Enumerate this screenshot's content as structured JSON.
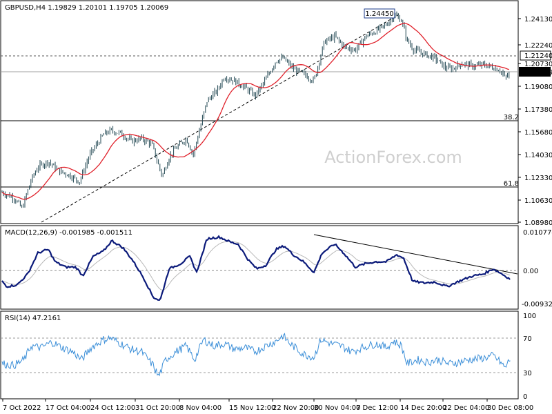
{
  "colors": {
    "candle": "#1f4550",
    "ma": "#e0202a",
    "macd": "#0b1a7a",
    "signal": "#b8b8b8",
    "rsi": "#3a8ed8",
    "frame": "#000000",
    "dotted": "#555555",
    "fibo": "#a0a0a0",
    "watermark": "#cfcfcf"
  },
  "price_panel": {
    "header": "GBPUSD,H4  1.19829 1.20101 1.19705 1.20069",
    "ticks": [
      "1.24130",
      "1.22240",
      "1.20730",
      "1.19080",
      "1.17380",
      "1.15680",
      "1.14030",
      "1.12330",
      "1.10630",
      "1.08980"
    ],
    "current_price_label": "1.20069",
    "resistance_label": "1.21240",
    "peak_label": "1.24450",
    "fib_382": "38.2",
    "fib_618": "61.8",
    "watermark": "ActionForex.com"
  },
  "macd_panel": {
    "header": "MACD(12,26,9) -0.001985 -0.001511",
    "ticks": [
      "0.010774",
      "0.00",
      "-0.009328"
    ]
  },
  "rsi_panel": {
    "header": "RSI(14) 47.2161",
    "ticks": [
      "100",
      "70",
      "30",
      "0"
    ]
  },
  "time_axis": [
    "7 Oct 2022",
    "17 Oct 04:00",
    "24 Oct 12:00",
    "31 Oct 20:00",
    "8 Nov 04:00",
    "15 Nov 12:00",
    "22 Nov 20:00",
    "30 Nov 04:00",
    "7 Dec 12:00",
    "14 Dec 20:00",
    "22 Dec 04:00",
    "30 Dec 08:00"
  ],
  "chart_data": {
    "type": "line",
    "title": "GBPUSD,H4",
    "x": [
      "7 Oct 2022",
      "17 Oct 04:00",
      "24 Oct 12:00",
      "31 Oct 20:00",
      "8 Nov 04:00",
      "15 Nov 12:00",
      "22 Nov 20:00",
      "30 Nov 04:00",
      "7 Dec 12:00",
      "14 Dec 20:00",
      "22 Dec 04:00",
      "30 Dec 08:00"
    ],
    "series": [
      {
        "name": "GBPUSD",
        "values": [
          1.112,
          1.131,
          1.158,
          1.124,
          1.148,
          1.182,
          1.213,
          1.223,
          1.228,
          1.216,
          1.204,
          1.2007
        ]
      }
    ],
    "ohlc_last": {
      "open": 1.19829,
      "high": 1.20101,
      "low": 1.19705,
      "close": 1.20069
    },
    "ylim": [
      1.0898,
      1.2413
    ],
    "levels": {
      "resistance": 1.2124,
      "fib_38_2": 1.1648,
      "fib_61_8": 1.1155,
      "peak": 1.2445
    },
    "macd": {
      "values": [
        -0.006,
        0.006,
        0.0075,
        -0.0085,
        0.009,
        0.003,
        0.007,
        0.0072,
        0.001,
        -0.004,
        -0.004,
        -0.0025
      ],
      "ylim": [
        -0.009328,
        0.010774
      ],
      "last": [
        -0.001985,
        -0.001511
      ]
    },
    "rsi": {
      "values": [
        38,
        67,
        72,
        25,
        70,
        58,
        68,
        75,
        72,
        36,
        42,
        47.2
      ],
      "ylim": [
        0,
        100
      ],
      "last": 47.2161
    }
  }
}
